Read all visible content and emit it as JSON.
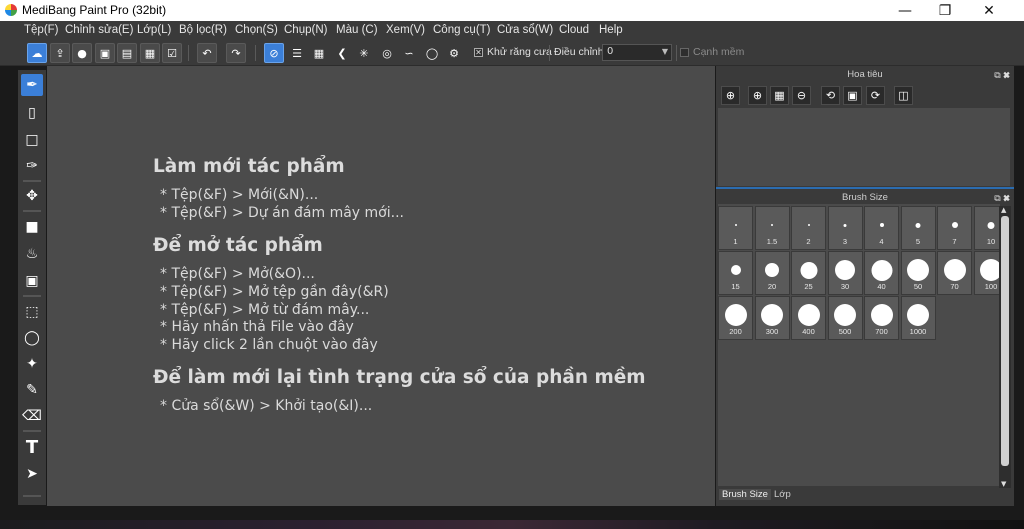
{
  "window": {
    "title": "MediBang Paint Pro (32bit)"
  },
  "menu": [
    "Tệp(F)",
    "Chỉnh sửa(E)",
    "Lớp(L)",
    "Bộ lọc(R)",
    "Chọn(S)",
    "Chụp(N)",
    "Màu (C)",
    "Xem(V)",
    "Công cụ(T)",
    "Cửa sổ(W)",
    "Cloud",
    "Help"
  ],
  "toolbar": {
    "antialias_label": "Khử răng cưa",
    "adjust_label": "Điều chỉnh",
    "adjust_value": "0",
    "edge_label": "Cạnh mềm"
  },
  "canvas": {
    "new_heading": "Làm mới tác phẩm",
    "new_lines": [
      "* Tệp(&F) > Mới(&N)...",
      "* Tệp(&F) > Dự án đám mây mới..."
    ],
    "open_heading": "Để mở tác phẩm",
    "open_lines": [
      "* Tệp(&F) > Mở(&O)...",
      "* Tệp(&F) > Mở tệp gần đây(&R)",
      "* Tệp(&F) > Mở từ đám mây...",
      "* Hãy nhấn thả File vào đây",
      "* Hãy click 2 lần chuột vào đây"
    ],
    "reset_heading": "Để làm mới lại tình trạng cửa sổ của phần mềm",
    "reset_lines": [
      "* Cửa sổ(&W) > Khởi tạo(&I)..."
    ]
  },
  "navigator": {
    "title": "Hoa tiêu"
  },
  "brush_panel": {
    "title": "Brush Size",
    "sizes": [
      "1",
      "1.5",
      "2",
      "3",
      "4",
      "5",
      "7",
      "10",
      "15",
      "20",
      "25",
      "30",
      "40",
      "50",
      "70",
      "100",
      "200",
      "300",
      "400",
      "500",
      "700",
      "1000"
    ]
  },
  "tabs": [
    "Brush Size",
    "Lớp"
  ]
}
